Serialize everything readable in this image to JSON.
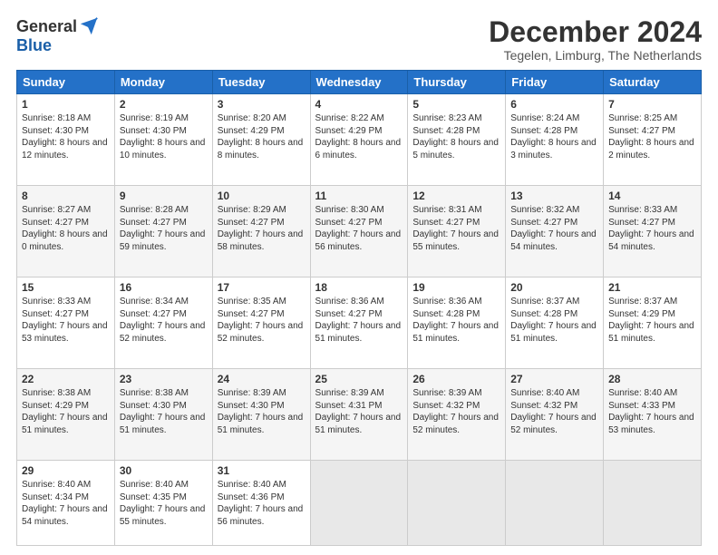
{
  "logo": {
    "general": "General",
    "blue": "Blue"
  },
  "title": "December 2024",
  "subtitle": "Tegelen, Limburg, The Netherlands",
  "days": [
    "Sunday",
    "Monday",
    "Tuesday",
    "Wednesday",
    "Thursday",
    "Friday",
    "Saturday"
  ],
  "weeks": [
    [
      {
        "day": "1",
        "sunrise": "Sunrise: 8:18 AM",
        "sunset": "Sunset: 4:30 PM",
        "daylight": "Daylight: 8 hours and 12 minutes."
      },
      {
        "day": "2",
        "sunrise": "Sunrise: 8:19 AM",
        "sunset": "Sunset: 4:30 PM",
        "daylight": "Daylight: 8 hours and 10 minutes."
      },
      {
        "day": "3",
        "sunrise": "Sunrise: 8:20 AM",
        "sunset": "Sunset: 4:29 PM",
        "daylight": "Daylight: 8 hours and 8 minutes."
      },
      {
        "day": "4",
        "sunrise": "Sunrise: 8:22 AM",
        "sunset": "Sunset: 4:29 PM",
        "daylight": "Daylight: 8 hours and 6 minutes."
      },
      {
        "day": "5",
        "sunrise": "Sunrise: 8:23 AM",
        "sunset": "Sunset: 4:28 PM",
        "daylight": "Daylight: 8 hours and 5 minutes."
      },
      {
        "day": "6",
        "sunrise": "Sunrise: 8:24 AM",
        "sunset": "Sunset: 4:28 PM",
        "daylight": "Daylight: 8 hours and 3 minutes."
      },
      {
        "day": "7",
        "sunrise": "Sunrise: 8:25 AM",
        "sunset": "Sunset: 4:27 PM",
        "daylight": "Daylight: 8 hours and 2 minutes."
      }
    ],
    [
      {
        "day": "8",
        "sunrise": "Sunrise: 8:27 AM",
        "sunset": "Sunset: 4:27 PM",
        "daylight": "Daylight: 8 hours and 0 minutes."
      },
      {
        "day": "9",
        "sunrise": "Sunrise: 8:28 AM",
        "sunset": "Sunset: 4:27 PM",
        "daylight": "Daylight: 7 hours and 59 minutes."
      },
      {
        "day": "10",
        "sunrise": "Sunrise: 8:29 AM",
        "sunset": "Sunset: 4:27 PM",
        "daylight": "Daylight: 7 hours and 58 minutes."
      },
      {
        "day": "11",
        "sunrise": "Sunrise: 8:30 AM",
        "sunset": "Sunset: 4:27 PM",
        "daylight": "Daylight: 7 hours and 56 minutes."
      },
      {
        "day": "12",
        "sunrise": "Sunrise: 8:31 AM",
        "sunset": "Sunset: 4:27 PM",
        "daylight": "Daylight: 7 hours and 55 minutes."
      },
      {
        "day": "13",
        "sunrise": "Sunrise: 8:32 AM",
        "sunset": "Sunset: 4:27 PM",
        "daylight": "Daylight: 7 hours and 54 minutes."
      },
      {
        "day": "14",
        "sunrise": "Sunrise: 8:33 AM",
        "sunset": "Sunset: 4:27 PM",
        "daylight": "Daylight: 7 hours and 54 minutes."
      }
    ],
    [
      {
        "day": "15",
        "sunrise": "Sunrise: 8:33 AM",
        "sunset": "Sunset: 4:27 PM",
        "daylight": "Daylight: 7 hours and 53 minutes."
      },
      {
        "day": "16",
        "sunrise": "Sunrise: 8:34 AM",
        "sunset": "Sunset: 4:27 PM",
        "daylight": "Daylight: 7 hours and 52 minutes."
      },
      {
        "day": "17",
        "sunrise": "Sunrise: 8:35 AM",
        "sunset": "Sunset: 4:27 PM",
        "daylight": "Daylight: 7 hours and 52 minutes."
      },
      {
        "day": "18",
        "sunrise": "Sunrise: 8:36 AM",
        "sunset": "Sunset: 4:27 PM",
        "daylight": "Daylight: 7 hours and 51 minutes."
      },
      {
        "day": "19",
        "sunrise": "Sunrise: 8:36 AM",
        "sunset": "Sunset: 4:28 PM",
        "daylight": "Daylight: 7 hours and 51 minutes."
      },
      {
        "day": "20",
        "sunrise": "Sunrise: 8:37 AM",
        "sunset": "Sunset: 4:28 PM",
        "daylight": "Daylight: 7 hours and 51 minutes."
      },
      {
        "day": "21",
        "sunrise": "Sunrise: 8:37 AM",
        "sunset": "Sunset: 4:29 PM",
        "daylight": "Daylight: 7 hours and 51 minutes."
      }
    ],
    [
      {
        "day": "22",
        "sunrise": "Sunrise: 8:38 AM",
        "sunset": "Sunset: 4:29 PM",
        "daylight": "Daylight: 7 hours and 51 minutes."
      },
      {
        "day": "23",
        "sunrise": "Sunrise: 8:38 AM",
        "sunset": "Sunset: 4:30 PM",
        "daylight": "Daylight: 7 hours and 51 minutes."
      },
      {
        "day": "24",
        "sunrise": "Sunrise: 8:39 AM",
        "sunset": "Sunset: 4:30 PM",
        "daylight": "Daylight: 7 hours and 51 minutes."
      },
      {
        "day": "25",
        "sunrise": "Sunrise: 8:39 AM",
        "sunset": "Sunset: 4:31 PM",
        "daylight": "Daylight: 7 hours and 51 minutes."
      },
      {
        "day": "26",
        "sunrise": "Sunrise: 8:39 AM",
        "sunset": "Sunset: 4:32 PM",
        "daylight": "Daylight: 7 hours and 52 minutes."
      },
      {
        "day": "27",
        "sunrise": "Sunrise: 8:40 AM",
        "sunset": "Sunset: 4:32 PM",
        "daylight": "Daylight: 7 hours and 52 minutes."
      },
      {
        "day": "28",
        "sunrise": "Sunrise: 8:40 AM",
        "sunset": "Sunset: 4:33 PM",
        "daylight": "Daylight: 7 hours and 53 minutes."
      }
    ],
    [
      {
        "day": "29",
        "sunrise": "Sunrise: 8:40 AM",
        "sunset": "Sunset: 4:34 PM",
        "daylight": "Daylight: 7 hours and 54 minutes."
      },
      {
        "day": "30",
        "sunrise": "Sunrise: 8:40 AM",
        "sunset": "Sunset: 4:35 PM",
        "daylight": "Daylight: 7 hours and 55 minutes."
      },
      {
        "day": "31",
        "sunrise": "Sunrise: 8:40 AM",
        "sunset": "Sunset: 4:36 PM",
        "daylight": "Daylight: 7 hours and 56 minutes."
      },
      null,
      null,
      null,
      null
    ]
  ]
}
